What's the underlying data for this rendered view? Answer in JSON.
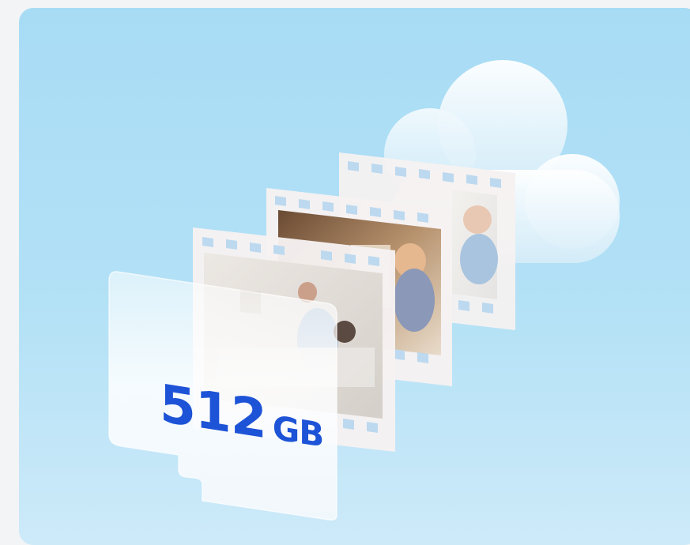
{
  "storage_card": {
    "capacity_value": "512",
    "capacity_unit": "GB"
  },
  "colors": {
    "background_top": "#a8dcf5",
    "background_bottom": "#cdeaf9",
    "capacity_text": "#1d53d6",
    "film_frame": "#f6f1f1",
    "cloud": "#eef8fd"
  },
  "icons": [
    "cloud-icon",
    "film-strip-icon",
    "micro-sd-card-icon"
  ]
}
